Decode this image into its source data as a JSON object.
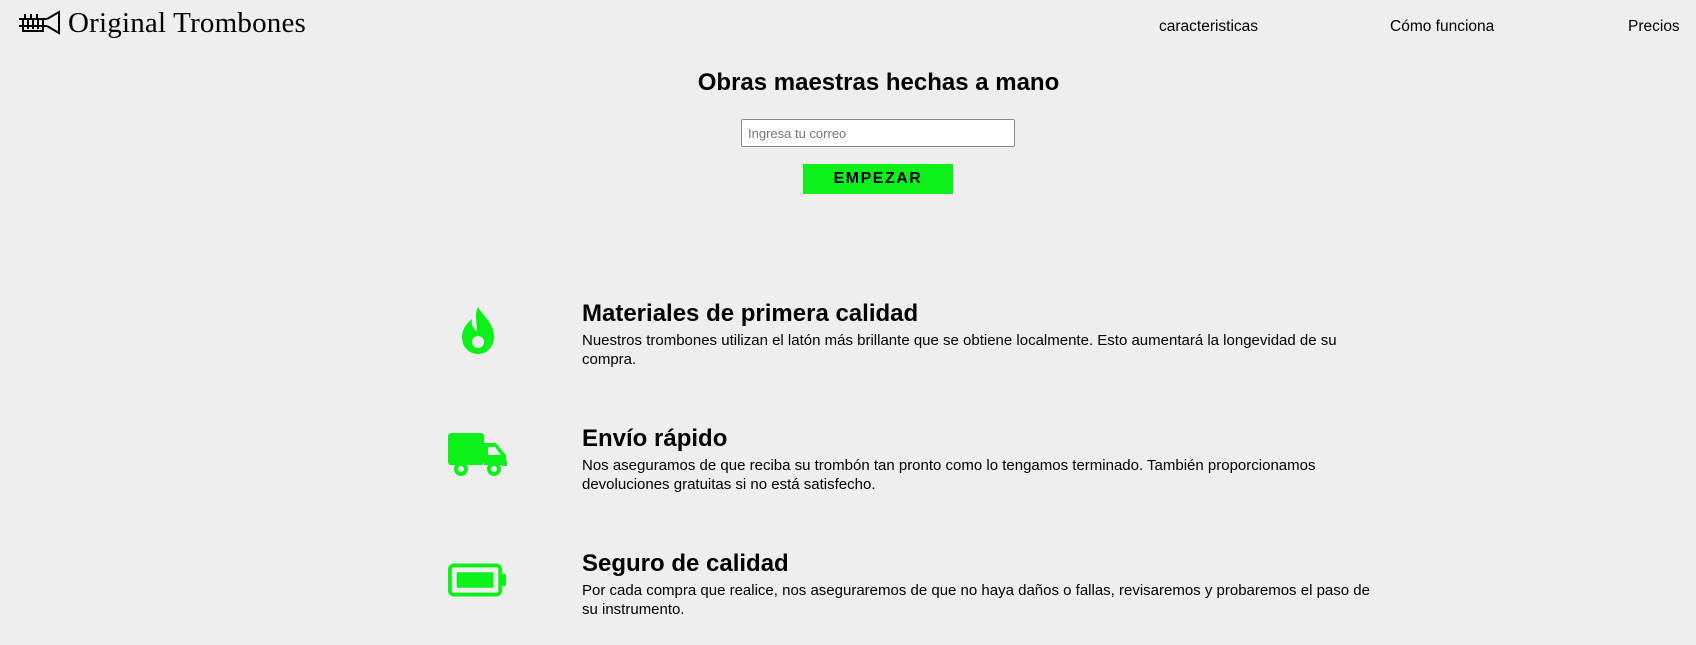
{
  "header": {
    "brand": "Original Trombones",
    "nav": [
      {
        "label": "caracteristicas"
      },
      {
        "label": "Cómo funciona"
      },
      {
        "label": "Precios"
      }
    ]
  },
  "hero": {
    "title": "Obras maestras hechas a mano",
    "email_placeholder": "Ingresa tu correo",
    "email_value": "",
    "button_label": "EMPEZAR"
  },
  "features": [
    {
      "icon": "fire-icon",
      "title": "Materiales de primera calidad",
      "description": "Nuestros trombones utilizan el latón más brillante que se obtiene localmente. Esto aumentará la longevidad de su compra."
    },
    {
      "icon": "truck-icon",
      "title": "Envío rápido",
      "description": "Nos aseguramos de que reciba su trombón tan pronto como lo tengamos terminado. También proporcionamos devoluciones gratuitas si no está satisfecho."
    },
    {
      "icon": "battery-full-icon",
      "title": "Seguro de calidad",
      "description": "Por cada compra que realice, nos aseguraremos de que no haya daños o fallas, revisaremos y probaremos el paso de su instrumento."
    }
  ],
  "colors": {
    "background": "#eeeeee",
    "accent": "#0cf11a",
    "text": "#000000"
  }
}
